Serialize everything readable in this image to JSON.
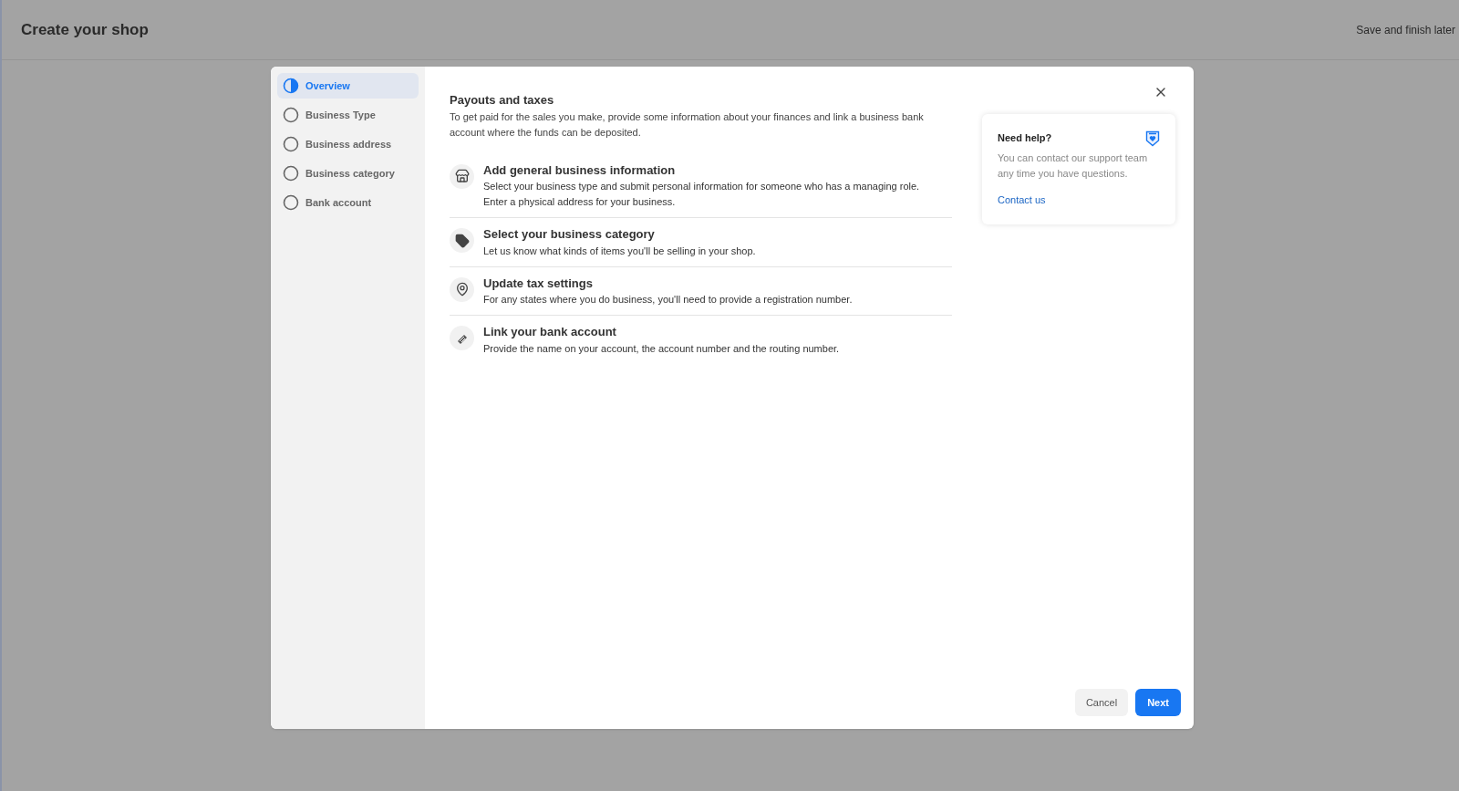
{
  "header": {
    "title": "Create your shop",
    "action": "Save and finish later"
  },
  "steps": [
    {
      "label": "Overview",
      "selected": true
    },
    {
      "label": "Business Type",
      "selected": false
    },
    {
      "label": "Business address",
      "selected": false
    },
    {
      "label": "Business category",
      "selected": false
    },
    {
      "label": "Bank account",
      "selected": false
    }
  ],
  "section": {
    "title": "Payouts and taxes",
    "description": "To get paid for the sales you make, provide some information about your finances and link a business bank account where the funds can be deposited."
  },
  "tasks": [
    {
      "kind": "store",
      "title": "Add general business information",
      "description": "Select your business type and submit personal information for someone who has a managing role. Enter a physical address for your business."
    },
    {
      "kind": "tag",
      "title": "Select your business category",
      "description": "Let us know what kinds of items you'll be selling in your shop."
    },
    {
      "kind": "pin",
      "title": "Update tax settings",
      "description": "For any states where you do business, you'll need to provide a registration number."
    },
    {
      "kind": "bank",
      "title": "Link your bank account",
      "description": "Provide the name on your account, the account number and the routing number."
    }
  ],
  "help": {
    "title": "Need help?",
    "text": "You can contact our support team any time you have questions.",
    "link": "Contact us"
  },
  "buttons": {
    "cancel": "Cancel",
    "next": "Next"
  }
}
